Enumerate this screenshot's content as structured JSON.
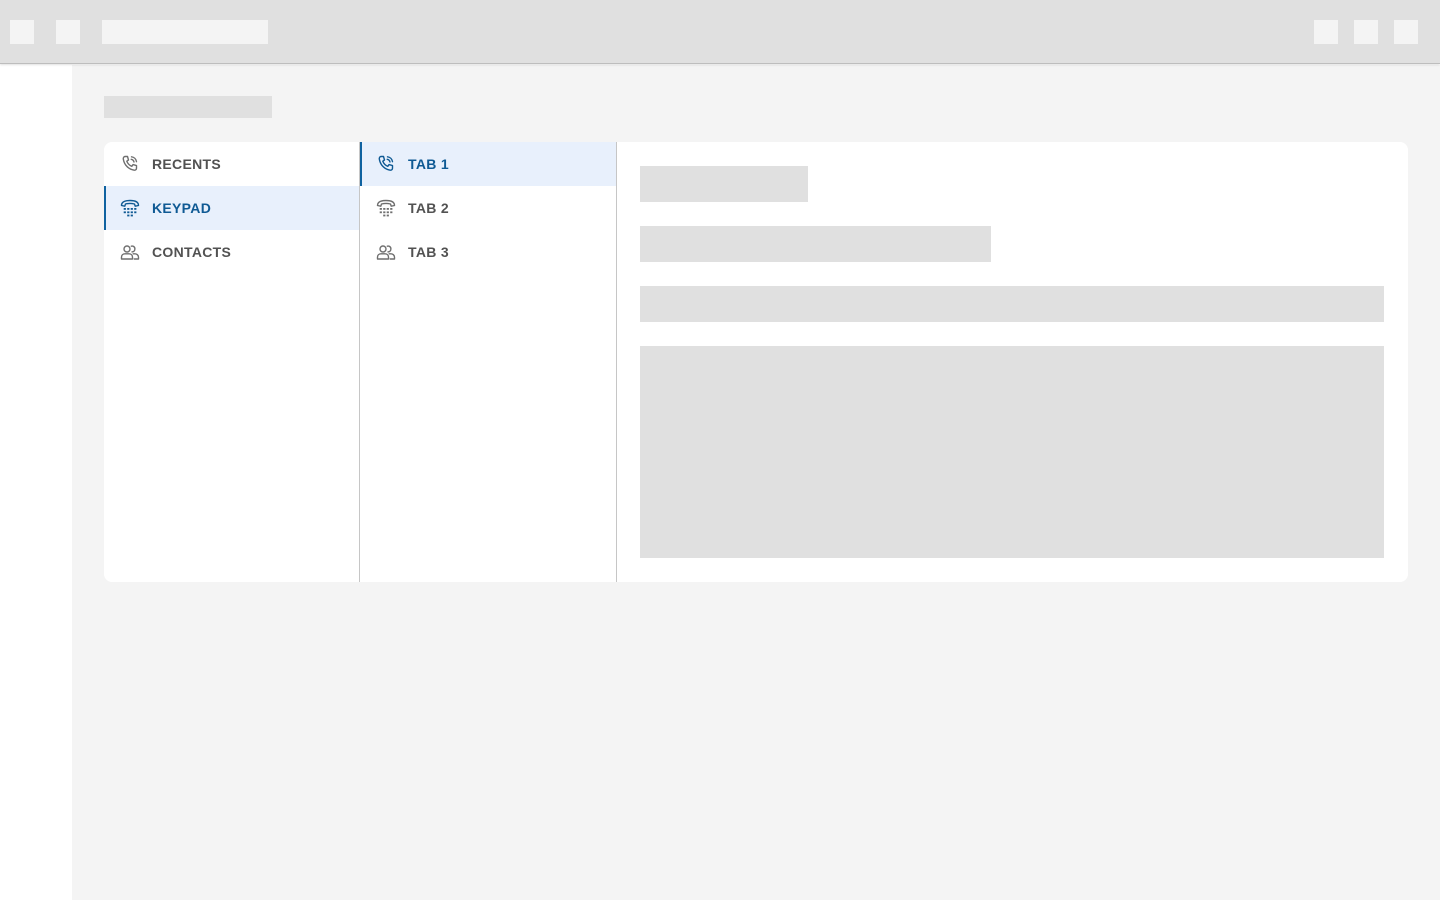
{
  "menu": {
    "items": [
      {
        "label": "RECENTS",
        "icon": "phone-icon",
        "active": false
      },
      {
        "label": "KEYPAD",
        "icon": "keypad-icon",
        "active": true
      },
      {
        "label": "CONTACTS",
        "icon": "contacts-icon",
        "active": false
      }
    ]
  },
  "tabs": {
    "items": [
      {
        "label": "TAB 1",
        "icon": "phone-icon",
        "active": true
      },
      {
        "label": "TAB 2",
        "icon": "keypad-icon",
        "active": false
      },
      {
        "label": "TAB 3",
        "icon": "contacts-icon",
        "active": false
      }
    ]
  },
  "colors": {
    "accent": "#0f5a94",
    "active_bg": "#e8f0fc",
    "placeholder": "#e0e0e0",
    "background": "#f4f4f4"
  }
}
